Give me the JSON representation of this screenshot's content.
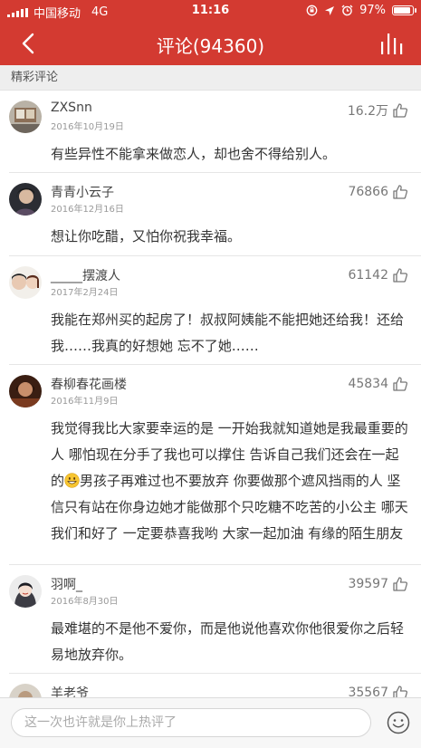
{
  "status_bar": {
    "carrier": "中国移动",
    "network": "4G",
    "time": "11:16",
    "battery": "97%",
    "battery_level": 0.97
  },
  "header": {
    "title": "评论(94360)"
  },
  "section": {
    "title": "精彩评论"
  },
  "comments": [
    {
      "user": "ZXSnn",
      "date": "2016年10月19日",
      "likes": "16.2万",
      "text": "有些异性不能拿来做恋人，却也舍不得给别人。"
    },
    {
      "user": "青青小云子",
      "date": "2016年12月16日",
      "likes": "76866",
      "text": "想让你吃醋，又怕你祝我幸福。"
    },
    {
      "user": "_____摆渡人",
      "date": "2017年2月24日",
      "likes": "61142",
      "text": "我能在郑州买的起房了！叔叔阿姨能不能把她还给我！还给我……我真的好想她 忘不了她……"
    },
    {
      "user": "春柳春花画楼",
      "date": "2016年11月9日",
      "likes": "45834",
      "text_before": "我觉得我比大家要幸运的是 一开始我就知道她是我最重要的人 哪怕现在分手了我也可以撑住 告诉自己我们还会在一起的",
      "text_after": "男孩子再难过也不要放弃 你要做那个遮风挡雨的人 坚信只有站在你身边她才能做那个只吃糖不吃苦的小公主 哪天我们和好了 一定要恭喜我哟 大家一起加油 有缘的陌生朋友"
    },
    {
      "user": "羽啊_",
      "date": "2016年8月30日",
      "likes": "39597",
      "text": "最难堪的不是他不爱你，而是他说他喜欢你他很爱你之后轻易地放弃你。"
    },
    {
      "user": "羊老爷",
      "date": "",
      "likes": "35567",
      "text": ""
    }
  ],
  "input": {
    "placeholder": "这一次也许就是你上热评了"
  },
  "colors": {
    "brand": "#d33a31",
    "text": "#333333",
    "meta": "#999999"
  },
  "icons": [
    "back-icon",
    "chart-icon",
    "thumb-up-icon",
    "smiley-icon",
    "grinning-emoji"
  ]
}
